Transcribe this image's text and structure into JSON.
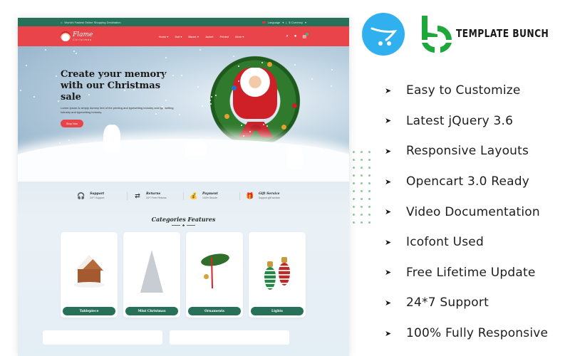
{
  "preview": {
    "topbar": {
      "tagline": "World's Fastest Online Shopping Destination",
      "language": "Language",
      "currency": "$ Currency"
    },
    "logo": {
      "name": "Flame",
      "sub": "Christmas"
    },
    "nav": [
      "Home ▾",
      "Suit ▾",
      "Blazer ▾",
      "Jacket",
      "Printed",
      "More ▾"
    ],
    "icons": {
      "search": "⌕",
      "account": "👤",
      "cart": "🛒"
    },
    "hero": {
      "title": "Create your memory with our Christmas sale",
      "description": "Lorem Ipsum is simply dummy text of the printing and typesetting industry and typesetting industry and typesetting industry.",
      "button": "Shop Now"
    },
    "features": [
      {
        "icon": "headset-icon",
        "glyph": "🎧",
        "title": "Support",
        "sub": "24*7 Support"
      },
      {
        "icon": "returns-icon",
        "glyph": "⇄",
        "title": "Returns",
        "sub": "24*7 Free Returns"
      },
      {
        "icon": "money-bag-icon",
        "glyph": "💰",
        "title": "Payment",
        "sub": "100% Secure"
      },
      {
        "icon": "gift-icon",
        "glyph": "🎁",
        "title": "Gift Service",
        "sub": "Support gift service"
      }
    ],
    "categories": {
      "title": "Categories Features",
      "ornament": "♣",
      "items": [
        {
          "label": "Tablepiece"
        },
        {
          "label": "Mini Christmas"
        },
        {
          "label": "Ornaments"
        },
        {
          "label": "Lights"
        }
      ]
    }
  },
  "brand": {
    "name": "TEMPLATE BUNCH",
    "colors": {
      "opencart": "#30b0ef",
      "templatebunch": "#1ea83c",
      "topbar": "#27705a",
      "navbar": "#e8444a"
    }
  },
  "feature_list": [
    "Easy to Customize",
    "Latest jQuery 3.6",
    "Responsive Layouts",
    "Opencart 3.0 Ready",
    "Video Documentation",
    "Icofont Used",
    "Free Lifetime Update",
    "24*7 Support",
    "100% Fully Responsive"
  ]
}
